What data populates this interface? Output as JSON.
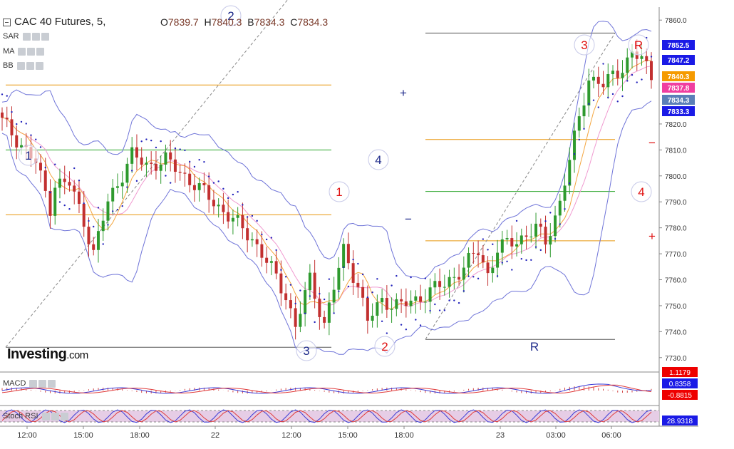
{
  "header": {
    "title": "CAC 40 Futures, 5,",
    "open_label": "O",
    "open": "7839.7",
    "high_label": "H",
    "high": "7840.3",
    "low_label": "B",
    "low": "7834.3",
    "close_label": "C",
    "close": "7834.3"
  },
  "indicators": [
    "SAR",
    "MA",
    "BB"
  ],
  "watermark": {
    "brand": "Investing",
    "domain": ".com"
  },
  "macd": {
    "label": "MACD",
    "values": [
      "1.1179",
      "0.8358",
      "-0.8815"
    ],
    "colors": [
      "#ee0000",
      "#1a1ae6",
      "#ee0000"
    ]
  },
  "stoch": {
    "label": "Stoch RSI",
    "value": "28.9318",
    "color": "#1a1ae6"
  },
  "price_badges": [
    {
      "text": "7852.5",
      "color": "#1a1ae6"
    },
    {
      "text": "7847.2",
      "color": "#1a1ae6"
    },
    {
      "text": "7840.3",
      "color": "#f59a00"
    },
    {
      "text": "7837.8",
      "color": "#f03ea0"
    },
    {
      "text": "7834.3",
      "color": "#5b7fb8"
    },
    {
      "text": "7833.3",
      "color": "#1a1ae6"
    }
  ],
  "chart_data": {
    "type": "candlestick",
    "instrument": "CAC 40 Futures",
    "interval": "5",
    "ylim": [
      7725,
      7865
    ],
    "y_ticks": [
      7730,
      7740,
      7750,
      7760,
      7770,
      7780,
      7790,
      7800,
      7810,
      7820,
      7860
    ],
    "x_ticks": [
      "12:00",
      "15:00",
      "18:00",
      "22",
      "12:00",
      "15:00",
      "18:00",
      "23",
      "03:00",
      "06:00"
    ],
    "price_path": [
      [
        0,
        7821
      ],
      [
        4,
        7812
      ],
      [
        7,
        7805
      ],
      [
        10,
        7788
      ],
      [
        11,
        7797
      ],
      [
        14,
        7797
      ],
      [
        17,
        7783
      ],
      [
        19,
        7770
      ],
      [
        22,
        7790
      ],
      [
        27,
        7808
      ],
      [
        30,
        7804
      ],
      [
        34,
        7806
      ],
      [
        38,
        7800
      ],
      [
        44,
        7790
      ],
      [
        48,
        7783
      ],
      [
        52,
        7776
      ],
      [
        56,
        7764
      ],
      [
        59,
        7754
      ],
      [
        61,
        7742
      ],
      [
        64,
        7760
      ],
      [
        67,
        7743
      ],
      [
        71,
        7771
      ],
      [
        74,
        7758
      ],
      [
        76,
        7744
      ],
      [
        79,
        7752
      ],
      [
        83,
        7750
      ],
      [
        86,
        7752
      ],
      [
        89,
        7756
      ],
      [
        92,
        7758
      ],
      [
        96,
        7765
      ],
      [
        99,
        7771
      ],
      [
        101,
        7762
      ],
      [
        103,
        7772
      ],
      [
        107,
        7775
      ],
      [
        111,
        7780
      ],
      [
        113,
        7774
      ],
      [
        116,
        7790
      ],
      [
        119,
        7814
      ],
      [
        122,
        7838
      ],
      [
        125,
        7835
      ],
      [
        128,
        7840
      ],
      [
        131,
        7847
      ],
      [
        133,
        7845
      ],
      [
        135,
        7838
      ]
    ],
    "horizontal_levels": [
      {
        "y": 7835,
        "color": "orange",
        "segment": "left"
      },
      {
        "y": 7810,
        "color": "green",
        "segment": "left"
      },
      {
        "y": 7785,
        "color": "orange",
        "segment": "left"
      },
      {
        "y": 7734,
        "color": "dark",
        "segment": "left"
      },
      {
        "y": 7855,
        "color": "dark",
        "segment": "right"
      },
      {
        "y": 7814,
        "color": "orange",
        "segment": "right"
      },
      {
        "y": 7794,
        "color": "green",
        "segment": "right"
      },
      {
        "y": 7775,
        "color": "orange",
        "segment": "right"
      },
      {
        "y": 7737,
        "color": "dark",
        "segment": "right"
      }
    ],
    "annotations": [
      {
        "text": "1",
        "style": "blue-circle"
      },
      {
        "text": "2",
        "style": "blue-circle"
      },
      {
        "text": "3",
        "style": "blue-circle"
      },
      {
        "text": "4",
        "style": "blue-circle"
      },
      {
        "text": "1",
        "style": "red-circle"
      },
      {
        "text": "2",
        "style": "red-circle"
      },
      {
        "text": "3",
        "style": "red-circle"
      },
      {
        "text": "4",
        "style": "red-circle"
      },
      {
        "text": "R",
        "style": "red-circle"
      },
      {
        "text": "R",
        "style": "blue-plain"
      },
      {
        "text": "+",
        "style": "blue-plain"
      },
      {
        "text": "−",
        "style": "blue-plain"
      },
      {
        "text": "−",
        "style": "red-plain"
      },
      {
        "text": "+",
        "style": "red-plain"
      }
    ],
    "grid": true,
    "legend": "none"
  }
}
